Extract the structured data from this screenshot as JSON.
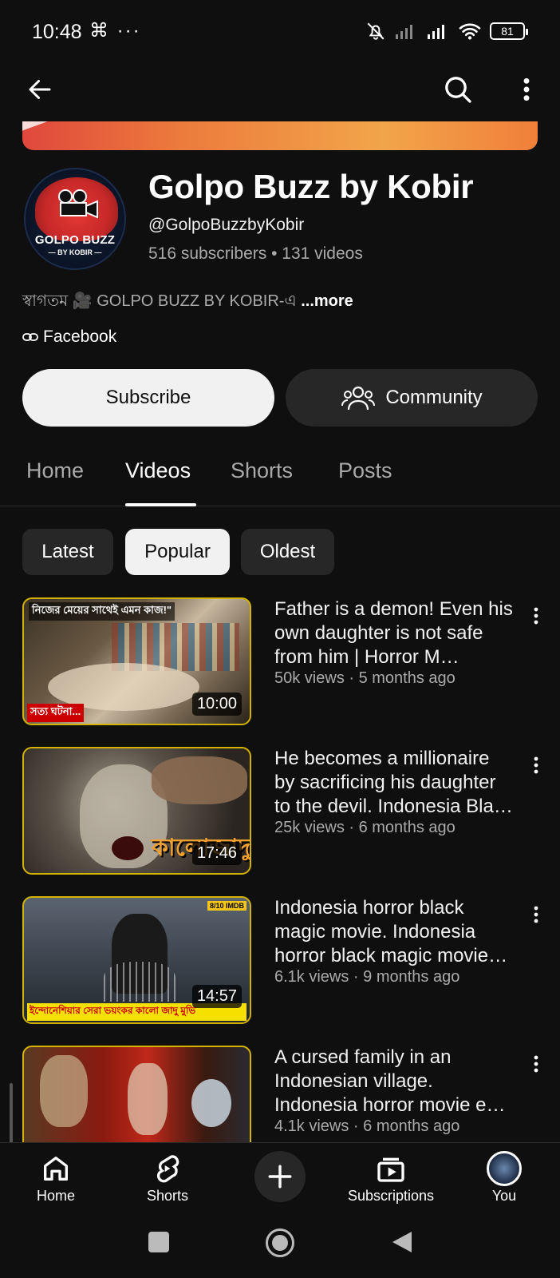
{
  "status_bar": {
    "time": "10:48",
    "extra": "⌘ ···",
    "battery": "81"
  },
  "channel": {
    "avatar_name": "GOLPO BUZZ",
    "avatar_sub": "— BY KOBIR —",
    "title": "Golpo Buzz by Kobir",
    "handle": "@GolpoBuzzbyKobir",
    "stats": "516 subscribers • 131 videos",
    "description": "স্বাগতম 🎥 GOLPO BUZZ BY KOBIR-এ ",
    "more": "...more",
    "link": "Facebook"
  },
  "actions": {
    "subscribe": "Subscribe",
    "community": "Community"
  },
  "tabs": [
    "Home",
    "Videos",
    "Shorts",
    "Posts"
  ],
  "chips": [
    "Latest",
    "Popular",
    "Oldest"
  ],
  "videos": [
    {
      "title": "Father is a demon! Even his own daughter is not safe from him | Horror M…",
      "meta": "50k views · 5 months ago",
      "duration": "10:00",
      "thumb_top": "নিজের মেয়ের সাথেই এমন কাজ!\"",
      "thumb_bottom": "সত্য ঘটনা..."
    },
    {
      "title": "He becomes a millionaire by sacrificing his daughter to the devil. Indonesia Bla…",
      "meta": "25k views · 6 months ago",
      "duration": "17:46",
      "thumb_word": "কালোজাদু"
    },
    {
      "title": "Indonesia horror black magic movie. Indonesia horror black magic movie…",
      "meta": "6.1k views · 9 months ago",
      "duration": "14:57",
      "thumb_badge": "8/10 IMDB",
      "thumb_bottom": "ইন্দোনেশিয়ার সেরা ভয়ংকর কালো জাদু মুভি"
    },
    {
      "title": "A cursed family in an Indonesian village. Indonesia horror movie e…",
      "meta": "4.1k views · 6 months ago"
    }
  ],
  "bottom_nav": {
    "home": "Home",
    "shorts": "Shorts",
    "subscriptions": "Subscriptions",
    "you": "You"
  }
}
